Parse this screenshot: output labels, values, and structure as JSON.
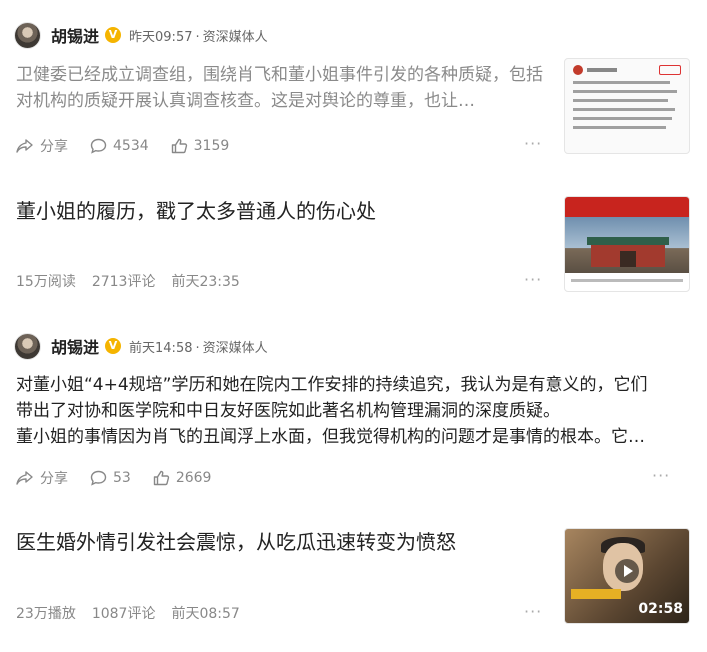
{
  "feed": [
    {
      "type": "post",
      "author": {
        "name": "胡锡进",
        "time": "昨天09:57",
        "role": "资深媒体人"
      },
      "text": "卫健委已经成立调查组，围绕肖飞和董小姐事件引发的各种质疑，包括对机构的质疑开展认真调查核查。这是对舆论的尊重，也让…",
      "actions": {
        "share": "分享",
        "comments": "4534",
        "likes": "3159"
      },
      "more": "···",
      "thumb_icon": "document-thumbnail"
    },
    {
      "type": "article",
      "title": "董小姐的履历，戳了太多普通人的伤心处",
      "stats": {
        "reads": "15万阅读",
        "comments": "2713评论",
        "time": "前天23:35"
      },
      "more": "···",
      "thumb_icon": "hospital-gate-thumbnail"
    },
    {
      "type": "post",
      "author": {
        "name": "胡锡进",
        "time": "前天14:58",
        "role": "资深媒体人"
      },
      "text_lines": [
        "对董小姐“4+4规培”学历和她在院内工作安排的持续追究，我认为是有意义的，它们",
        "带出了对协和医学院和中日友好医院如此著名机构管理漏洞的深度质疑。",
        "董小姐的事情因为肖飞的丑闻浮上水面，但我觉得机构的问题才是事情的根本。它…"
      ],
      "actions": {
        "share": "分享",
        "comments": "53",
        "likes": "2669"
      },
      "more": "···"
    },
    {
      "type": "video",
      "title": "医生婚外情引发社会震惊，从吃瓜迅速转变为愤怒",
      "stats": {
        "plays": "23万播放",
        "comments": "1087评论",
        "time": "前天08:57"
      },
      "more": "···",
      "duration": "02:58",
      "thumb_icon": "video-thumbnail"
    }
  ],
  "colors": {
    "verified": "#f5b400",
    "meta": "#888888",
    "text": "#222222"
  }
}
